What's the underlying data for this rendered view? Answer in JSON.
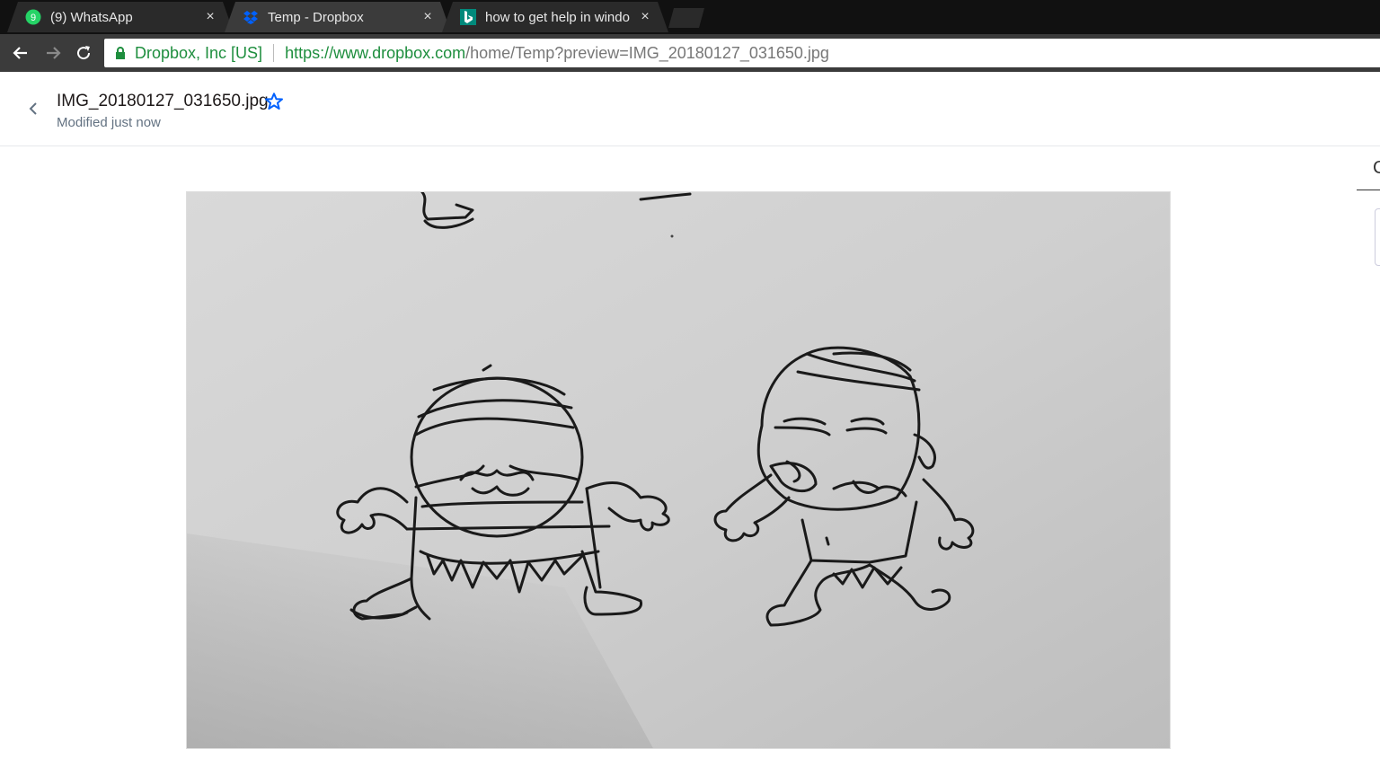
{
  "tabs": [
    {
      "title": "(9) WhatsApp",
      "favicon": "whatsapp-icon",
      "badge": "9",
      "close": "×"
    },
    {
      "title": "Temp - Dropbox",
      "favicon": "dropbox-icon",
      "close": "×"
    },
    {
      "title": "how to get help in windo",
      "favicon": "bing-icon",
      "close": "×"
    }
  ],
  "address_bar": {
    "org": "Dropbox, Inc [US]",
    "url_host": "https://www.dropbox.com",
    "url_path": "/home/Temp?preview=IMG_20180127_031650.jpg"
  },
  "file": {
    "name": "IMG_20180127_031650.jpg",
    "modified": "Modified just now"
  },
  "right_panel": {
    "letter": "C"
  },
  "colors": {
    "accent": "#0061fe",
    "secure": "#1e8e3e"
  }
}
